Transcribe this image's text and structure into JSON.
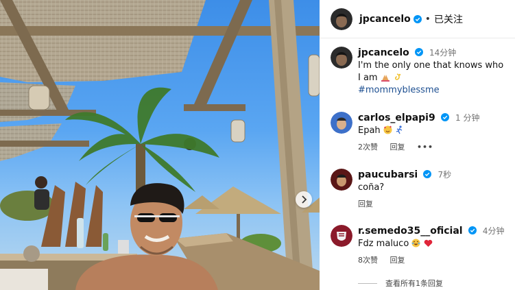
{
  "post": {
    "author": "jpcancelo",
    "follow_status": "已关注",
    "separator": "•",
    "caption": {
      "username": "jpcancelo",
      "time": "14分钟",
      "text": "I'm the only one that knows who I am",
      "hashtag": "#mommyblessme"
    }
  },
  "comments": [
    {
      "username": "carlos_elpapi9",
      "time": "1 分钟",
      "text": "Epah",
      "likes": "2次赞",
      "reply_label": "回复",
      "more": "•••"
    },
    {
      "username": "paucubarsi",
      "time": "7秒",
      "text": "coña?",
      "reply_label": "回复"
    },
    {
      "username": "r.semedo35__oficial",
      "time": "4分钟",
      "text": "Fdz maluco",
      "likes": "8次赞",
      "reply_label": "回复"
    }
  ],
  "view_all_replies": "查看所有1条回复",
  "icons": {
    "verified": "verified-badge-icon",
    "heart": "heart-outline-icon",
    "next": "chevron-right-icon"
  },
  "colors": {
    "verified": "#0095f6",
    "hashtag": "#1d4f91",
    "muted": "#737373"
  }
}
